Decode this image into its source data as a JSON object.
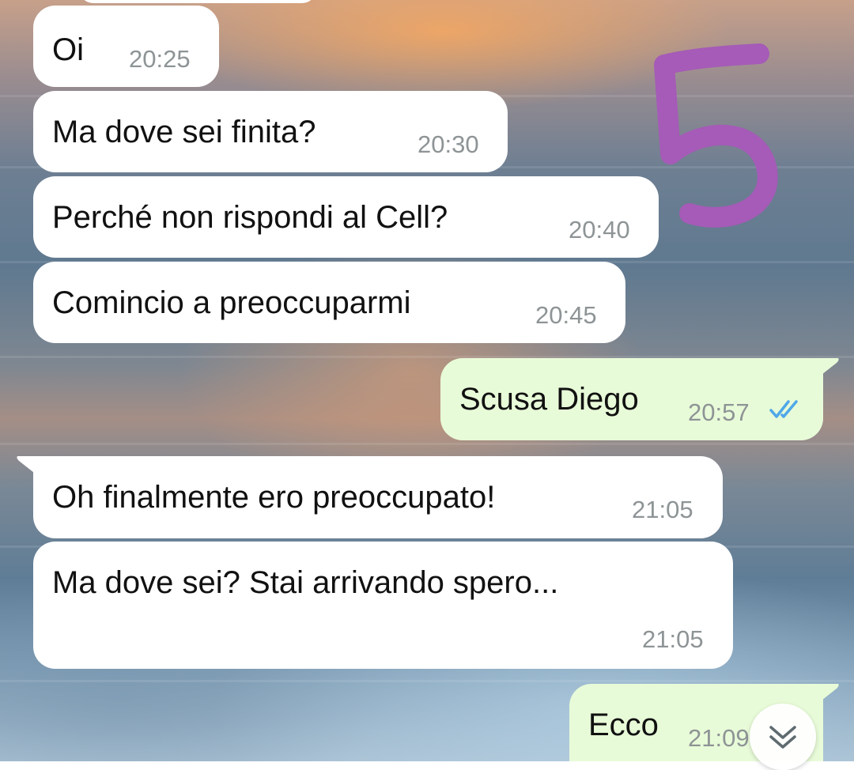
{
  "annotation": {
    "number": "5",
    "color": "#a55bb7"
  },
  "colors": {
    "incoming_bubble": "#ffffff",
    "outgoing_bubble": "#e8fbd8",
    "time_text": "#8e9496",
    "read_ticks": "#4fa8e8"
  },
  "messages": [
    {
      "direction": "incoming",
      "text": "Oi",
      "time": "20:25"
    },
    {
      "direction": "incoming",
      "text": "Ma dove sei finita?",
      "time": "20:30"
    },
    {
      "direction": "incoming",
      "text": "Perché non rispondi al Cell?",
      "time": "20:40"
    },
    {
      "direction": "incoming",
      "text": "Comincio a preoccuparmi",
      "time": "20:45"
    },
    {
      "direction": "outgoing",
      "text": "Scusa Diego",
      "time": "20:57",
      "status": "read"
    },
    {
      "direction": "incoming",
      "text": "Oh finalmente ero preoccupato!",
      "time": "21:05"
    },
    {
      "direction": "incoming",
      "text": "Ma dove sei? Stai arrivando spero...",
      "time": "21:05"
    },
    {
      "direction": "outgoing",
      "text": "Ecco",
      "time": "21:09",
      "status": "read"
    }
  ],
  "scroll_button": {
    "icon": "double-chevron-down-icon"
  }
}
